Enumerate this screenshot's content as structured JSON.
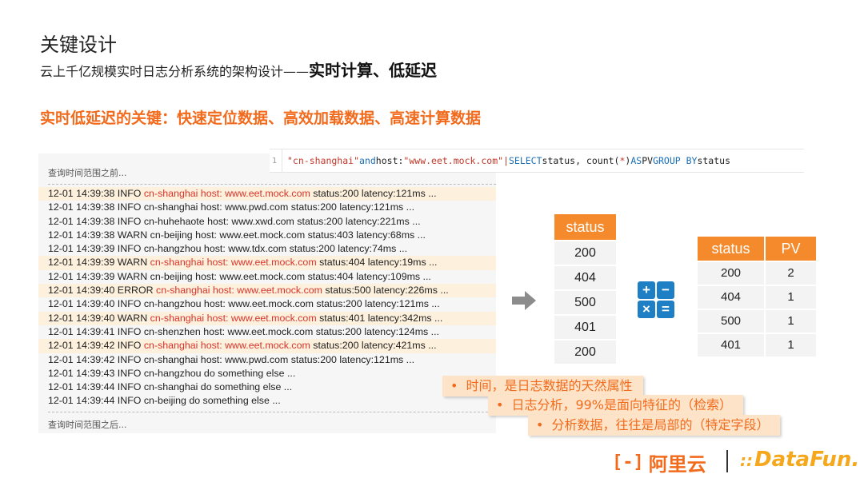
{
  "slide": {
    "title": "关键设计",
    "subtitle_plain": "云上千亿规模实时日志分析系统的架构设计——",
    "subtitle_bold": "实时计算、低延迟",
    "headline": "实时低延迟的关键：快速定位数据、高效加载数据、高速计算数据"
  },
  "query": {
    "line_number": "1",
    "parts": {
      "p1": "\"cn-shanghai\"",
      "p2": " and ",
      "p3": "host: ",
      "p4": "\"www.eet.mock.com\"",
      "p5": " | ",
      "p6": "SELECT",
      "p7": " status, count(",
      "p8": "*",
      "p9": ") ",
      "p10": "AS",
      "p11": " PV ",
      "p12": "GROUP BY",
      "p13": " status"
    }
  },
  "log_panel": {
    "before_label": "查询时间范围之前...",
    "after_label": "查询时间范围之后...",
    "lines": [
      {
        "pre": "12-01 14:39:38 INFO ",
        "red": "cn-shanghai host: www.eet.mock.com",
        "post": " status:200 latency:121ms ...",
        "highlight": true
      },
      {
        "pre": "12-01 14:39:38 INFO cn-shanghai host: www.pwd.com status:200 latency:121ms ...",
        "red": "",
        "post": "",
        "highlight": false
      },
      {
        "pre": "12-01 14:39:38 INFO cn-huhehaote host: www.xwd.com status:200 latency:221ms ...",
        "red": "",
        "post": "",
        "highlight": false
      },
      {
        "pre": "12-01 14:39:38 WARN cn-beijing host: www.eet.mock.com status:403 latency:68ms ...",
        "red": "",
        "post": "",
        "highlight": false
      },
      {
        "pre": "12-01 14:39:39 INFO cn-hangzhou host: www.tdx.com status:200 latency:74ms ...",
        "red": "",
        "post": "",
        "highlight": false
      },
      {
        "pre": "12-01 14:39:39 WARN ",
        "red": "cn-shanghai host: www.eet.mock.com",
        "post": " status:404 latency:19ms ...",
        "highlight": true
      },
      {
        "pre": "12-01 14:39:39 WARN cn-beijing host: www.eet.mock.com status:404 latency:109ms ...",
        "red": "",
        "post": "",
        "highlight": false
      },
      {
        "pre": "12-01 14:39:40 ERROR ",
        "red": "cn-shanghai host: www.eet.mock.com",
        "post": " status:500 latency:226ms ...",
        "highlight": true
      },
      {
        "pre": "12-01 14:39:40 INFO cn-hangzhou host: www.eet.mock.com status:200 latency:121ms ...",
        "red": "",
        "post": "",
        "highlight": false
      },
      {
        "pre": "12-01 14:39:40 WARN ",
        "red": "cn-shanghai host: www.eet.mock.com",
        "post": " status:401 latency:342ms ...",
        "highlight": true
      },
      {
        "pre": "12-01 14:39:41 INFO cn-shenzhen host: www.eet.mock.com status:200 latency:124ms ...",
        "red": "",
        "post": "",
        "highlight": false
      },
      {
        "pre": "12-01 14:39:42 INFO ",
        "red": "cn-shanghai host: www.eet.mock.com",
        "post": " status:200 latency:421ms ...",
        "highlight": true
      },
      {
        "pre": "12-01 14:39:42 INFO cn-shanghai host: www.pwd.com status:200 latency:121ms ...",
        "red": "",
        "post": "",
        "highlight": false
      },
      {
        "pre": "12-01 14:39:43 INFO cn-hangzhou do something else ...",
        "red": "",
        "post": "",
        "highlight": false
      },
      {
        "pre": "12-01 14:39:44 INFO cn-shanghai do something else ...",
        "red": "",
        "post": "",
        "highlight": false
      },
      {
        "pre": "12-01 14:39:44 INFO cn-beijing do something else ...",
        "red": "",
        "post": "",
        "highlight": false
      }
    ]
  },
  "status_table": {
    "header": "status",
    "values": [
      "200",
      "404",
      "500",
      "401",
      "200"
    ]
  },
  "operators": [
    "+",
    "−",
    "×",
    "="
  ],
  "result_table": {
    "headers": [
      "status",
      "PV"
    ],
    "rows": [
      [
        "200",
        "2"
      ],
      [
        "404",
        "1"
      ],
      [
        "500",
        "1"
      ],
      [
        "401",
        "1"
      ]
    ]
  },
  "callouts": [
    "时间，是日志数据的天然属性",
    "日志分析，99%是面向特征的（检索）",
    "分析数据，往往是局部的（特定字段）"
  ],
  "bullet": "•",
  "logos": {
    "alibaba_mark": "[-]",
    "alibaba_text": "阿里云",
    "datafun_mark": "::",
    "datafun_text": "DataFun."
  },
  "colors": {
    "accent_orange": "#f58a2c",
    "headline_orange": "#f26b1d",
    "highlight_bg": "#fdf0dc",
    "callout_bg": "#fde4c8",
    "operator_blue": "#1e7fc4",
    "log_red": "#d9342b"
  }
}
